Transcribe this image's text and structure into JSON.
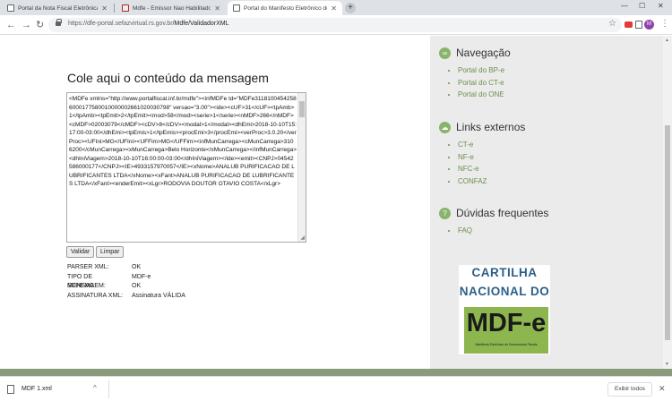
{
  "browser": {
    "tabs": [
      {
        "title": "Portal da Nota Fiscal Eletrônica",
        "active": false
      },
      {
        "title": "Mdfe - Emissor Nao Habilitado",
        "active": false
      },
      {
        "title": "Portal do Manifesto Eletrônico de Documentos Fiscais",
        "active": true
      }
    ],
    "new_tab": "+",
    "window_controls": {
      "minimize": "—",
      "maximize": "☐",
      "close": "✕"
    },
    "url_host": "https://dfe-portal.sefazvirtual.rs.gov.br",
    "url_path": "/Mdfe/ValidadorXML",
    "avatar_letter": "M",
    "star": "☆",
    "menu": "⋮"
  },
  "main": {
    "title": "Cole aqui o conteúdo da mensagem",
    "xml_content": "<MDFe xmlns=\"http://www.portalfiscal.inf.br/mdfe\"><infMDFe Id=\"MDFe31181004542586000177580010000002661020030798\" versao=\"3.00\"><ide><cUF>31</cUF><tpAmb>1</tpAmb><tpEmit>2</tpEmit><mod>58</mod><serie>1</serie><nMDF>266</nMDF><cMDF>02003079</cMDF><cDV>8</cDV><modal>1</modal><dhEmi>2018-10-10T15:17:00-03:00</dhEmi><tpEmis>1</tpEmis><procEmi>3</procEmi><verProc>3.0.20</verProc><UFIni>MG</UFIni><UFFim>MG</UFFim><infMunCarrega><cMunCarrega>3106200</cMunCarrega><xMunCarrega>Belo Horizonte</xMunCarrega></infMunCarrega><dhIniViagem>2018-10-10T16:00:00-03:00</dhIniViagem></ide><emit><CNPJ>04542586000177</CNPJ><IE>4933157970057</IE><xNome>ANALUB PURIFICACAO DE LUBRIFICANTES LTDA</xNome><xFant>ANALUB PURIFICACAO DE LUBRIFICANTES LTDA</xFant><enderEmit><xLgr>RODOVIA DOUTOR OTAVIO COSTA</xLgr>",
    "validate_button": "Validar",
    "clear_button": "Limpar",
    "results": [
      {
        "label": "PARSER XML:",
        "value": "OK"
      },
      {
        "label": "TIPO DE MENSAGEM:",
        "value": "MDF-e"
      },
      {
        "label": "SCHEMA:",
        "value": "OK"
      },
      {
        "label": "ASSINATURA XML:",
        "value": "Assinatura VÁLIDA"
      }
    ]
  },
  "sidebar": {
    "navegacao": {
      "title": "Navegação",
      "items": [
        "Portal do BP-e",
        "Portal do CT-e",
        "Portal do ONE"
      ]
    },
    "links_externos": {
      "title": "Links externos",
      "items": [
        "CT-e",
        "NF-e",
        "NFC-e",
        "CONFAZ"
      ]
    },
    "duvidas": {
      "title": "Dúvidas frequentes",
      "items": [
        "FAQ"
      ]
    },
    "cartilha": {
      "line1": "CARTILHA",
      "line2": "NACIONAL DO",
      "brand": "MDF-e",
      "subtitle": "Manifesto Eletrônico de Documentos Fiscais"
    },
    "accent_color": "#6a8f4d"
  },
  "downloads": {
    "file_name": "MDF 1.xml",
    "show_all": "Exibir todos"
  }
}
